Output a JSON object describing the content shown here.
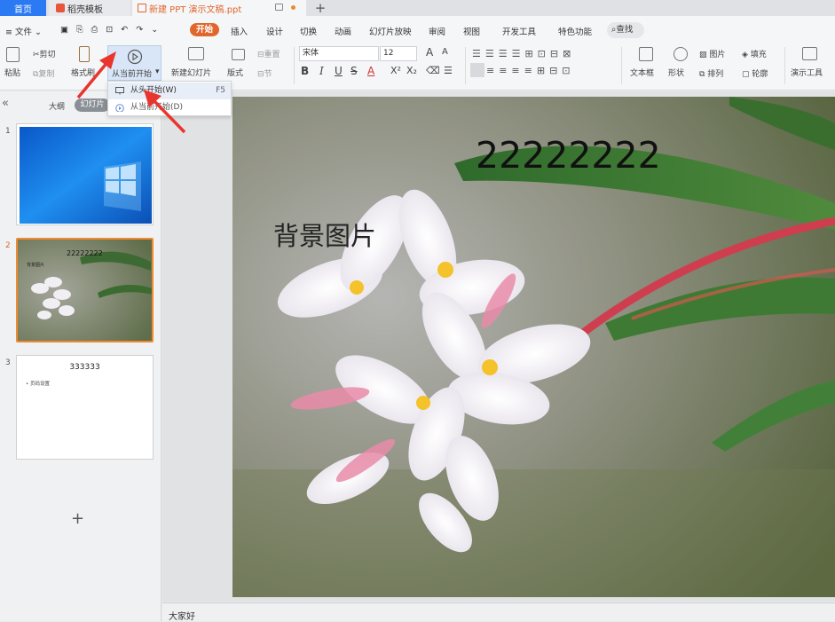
{
  "tabs": {
    "home": "首页",
    "template": "稻壳模板",
    "document": "新建 PPT 演示文稿.ppt",
    "new_tab": "+"
  },
  "menubar": {
    "file": "文件",
    "items": [
      "开始",
      "插入",
      "设计",
      "切换",
      "动画",
      "幻灯片放映",
      "审阅",
      "视图",
      "开发工具",
      "特色功能"
    ],
    "search": "查找"
  },
  "ribbon": {
    "paste": "粘贴",
    "cut": "剪切",
    "copy": "复制",
    "format_painter": "格式刷",
    "play_from_current": "从当前开始",
    "new_slide": "新建幻灯片",
    "layout": "版式",
    "reset": "重置",
    "section": "节",
    "font_name": "宋体",
    "font_size": "12",
    "text_box": "文本框",
    "shape": "形状",
    "picture": "图片",
    "arrange": "排列",
    "fill": "填充",
    "outline": "轮廓",
    "presentation_tools": "演示工具"
  },
  "dropdown": {
    "from_beginning": "从头开始(W)",
    "from_beginning_shortcut": "F5",
    "from_current": "从当前开始(D)"
  },
  "left_panel": {
    "outline_tab": "大纲",
    "slides_tab": "幻灯片",
    "slides": [
      {
        "number": "1"
      },
      {
        "number": "2",
        "title": "22222222",
        "body": "背景图片"
      },
      {
        "number": "3",
        "title": "333333",
        "bullet": "页码设置"
      }
    ],
    "add": "+"
  },
  "slide": {
    "title": "22222222",
    "body": "背景图片"
  },
  "notes": "大家好",
  "colors": {
    "accent": "#e0662d",
    "home_tab": "#2b79f3",
    "arrow": "#e8352e",
    "selected_thumb": "#f08a2e"
  }
}
